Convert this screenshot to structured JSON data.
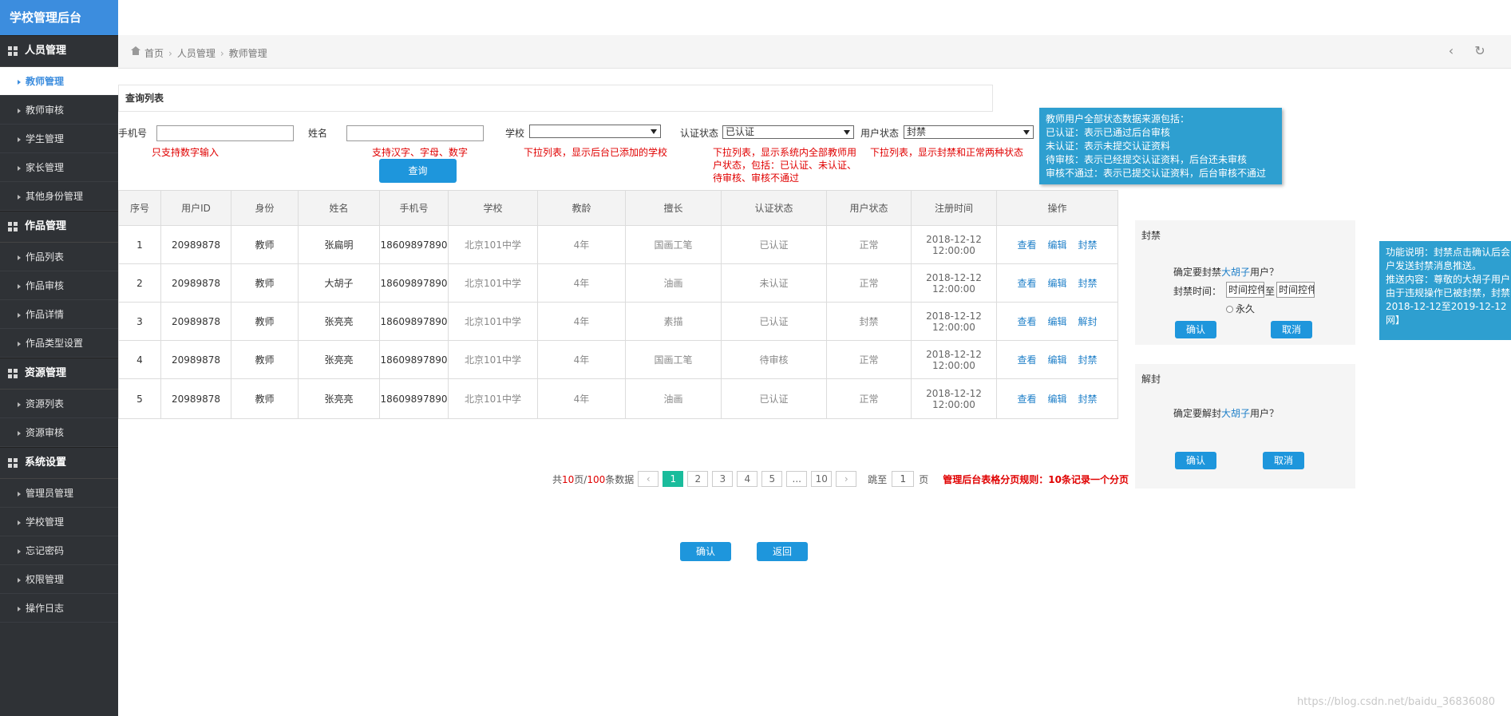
{
  "app": {
    "title": "学校管理后台"
  },
  "sidebar": {
    "groups": [
      {
        "label": "人员管理",
        "items": [
          "教师管理",
          "教师审核",
          "学生管理",
          "家长管理",
          "其他身份管理"
        ]
      },
      {
        "label": "作品管理",
        "items": [
          "作品列表",
          "作品审核",
          "作品详情",
          "作品类型设置"
        ]
      },
      {
        "label": "资源管理",
        "items": [
          "资源列表",
          "资源审核"
        ]
      },
      {
        "label": "系统设置",
        "items": [
          "管理员管理",
          "学校管理",
          "忘记密码",
          "权限管理",
          "操作日志"
        ]
      }
    ]
  },
  "breadcrumb": {
    "home": "首页",
    "level1": "人员管理",
    "level2": "教师管理"
  },
  "panel": {
    "title": "查询列表"
  },
  "filters": {
    "phone_label": "手机号",
    "phone_value": "",
    "name_label": "姓名",
    "name_value": "",
    "school_label": "学校",
    "school_value": "",
    "auth_label": "认证状态",
    "auth_value": "已认证",
    "user_status_label": "用户状态",
    "user_status_value": "封禁",
    "query_button": "查询"
  },
  "notes": {
    "phone": "只支持数字输入",
    "name": "支持汉字、字母、数字",
    "school": "下拉列表，显示后台已添加的学校",
    "auth_line1": "下拉列表，显示系统内全部教师用",
    "auth_line2": "户状态，包括：已认证、未认证、",
    "auth_line3": "待审核、审核不通过",
    "user_status": "下拉列表，显示封禁和正常两种状态"
  },
  "tooltip_status": {
    "line1": "教师用户全部状态数据来源包括：",
    "line2": "已认证：表示已通过后台审核",
    "line3": "未认证：表示未提交认证资料",
    "line4": "待审核：表示已经提交认证资料，后台还未审核",
    "line5": "审核不通过：表示已提交认证资料，后台审核不通过"
  },
  "table": {
    "headers": [
      "序号",
      "用户ID",
      "身份",
      "姓名",
      "手机号",
      "学校",
      "教龄",
      "擅长",
      "认证状态",
      "用户状态",
      "注册时间",
      "操作"
    ],
    "rows": [
      {
        "no": "1",
        "id": "20989878",
        "role": "教师",
        "name": "张扁明",
        "phone": "18609897890",
        "school": "北京101中学",
        "years": "4年",
        "skill": "国画工笔",
        "auth": "已认证",
        "status": "正常",
        "date": "2018-12-12",
        "time": "12:00:00",
        "op1": "查看",
        "op2": "编辑",
        "op3": "封禁"
      },
      {
        "no": "2",
        "id": "20989878",
        "role": "教师",
        "name": "大胡子",
        "phone": "18609897890",
        "school": "北京101中学",
        "years": "4年",
        "skill": "油画",
        "auth": "未认证",
        "status": "正常",
        "date": "2018-12-12",
        "time": "12:00:00",
        "op1": "查看",
        "op2": "编辑",
        "op3": "封禁"
      },
      {
        "no": "3",
        "id": "20989878",
        "role": "教师",
        "name": "张亮亮",
        "phone": "18609897890",
        "school": "北京101中学",
        "years": "4年",
        "skill": "素描",
        "auth": "已认证",
        "status": "封禁",
        "date": "2018-12-12",
        "time": "12:00:00",
        "op1": "查看",
        "op2": "编辑",
        "op3": "解封"
      },
      {
        "no": "4",
        "id": "20989878",
        "role": "教师",
        "name": "张亮亮",
        "phone": "18609897890",
        "school": "北京101中学",
        "years": "4年",
        "skill": "国画工笔",
        "auth": "待审核",
        "status": "正常",
        "date": "2018-12-12",
        "time": "12:00:00",
        "op1": "查看",
        "op2": "编辑",
        "op3": "封禁"
      },
      {
        "no": "5",
        "id": "20989878",
        "role": "教师",
        "name": "张亮亮",
        "phone": "18609897890",
        "school": "北京101中学",
        "years": "4年",
        "skill": "油画",
        "auth": "已认证",
        "status": "正常",
        "date": "2018-12-12",
        "time": "12:00:00",
        "op1": "查看",
        "op2": "编辑",
        "op3": "封禁"
      }
    ]
  },
  "pagination": {
    "total_prefix": "共",
    "pages": "10",
    "pages_unit": "页/",
    "records": "100",
    "records_unit": "条数据",
    "prev": "‹",
    "p1": "1",
    "p2": "2",
    "p3": "3",
    "p4": "4",
    "p5": "5",
    "ellipsis": "...",
    "p10": "10",
    "next": "›",
    "jump_label": "跳至",
    "jump_value": "1",
    "jump_unit": "页",
    "rule_note": "管理后台表格分页规则：10条记录一个分页"
  },
  "ban_dialog": {
    "title": "封禁",
    "confirm_prefix": "确定要封禁",
    "user": "大胡子",
    "confirm_suffix": "用户？",
    "time_label": "封禁时间：",
    "time_from": "时间控件",
    "to": "至",
    "time_to": "时间控件",
    "forever": "永久",
    "ok": "确认",
    "cancel": "取消"
  },
  "unban_dialog": {
    "title": "解封",
    "confirm_prefix": "确定要解封",
    "user": "大胡子",
    "confirm_suffix": "用户？",
    "ok": "确认",
    "cancel": "取消"
  },
  "tooltip_func": {
    "line1": "功能说明：封禁点击确认后会",
    "line2": "户发送封禁消息推送。",
    "line3": "推送内容：尊敬的大胡子用户",
    "line4": "由于违规操作已被封禁，封禁",
    "line5": "2018-12-12至2019-12-12",
    "line6": "网】"
  },
  "footer": {
    "confirm": "确认",
    "back": "返回"
  },
  "watermark": "https://blog.csdn.net/baidu_36836080"
}
